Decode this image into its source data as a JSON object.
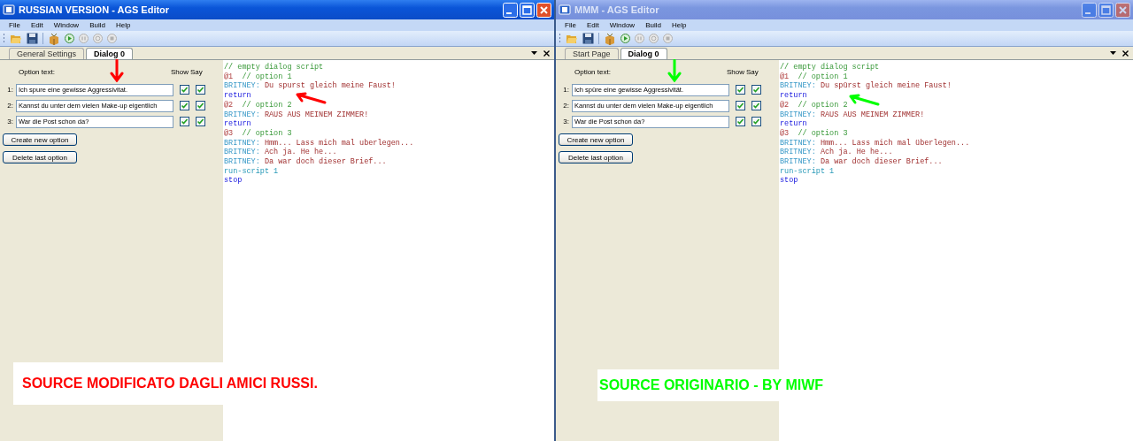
{
  "windows": [
    {
      "title": "RUSSIAN VERSION - AGS Editor",
      "active": true,
      "menu": [
        "File",
        "Edit",
        "Window",
        "Build",
        "Help"
      ],
      "tabs": [
        {
          "label": "General Settings",
          "selected": false
        },
        {
          "label": "Dialog 0",
          "selected": true
        }
      ],
      "option_header": {
        "label": "Option text:",
        "show": "Show",
        "say": "Say"
      },
      "options": [
        {
          "number": "1:",
          "text": "Ich spure eine gewisse Aggressivitat.",
          "show": true,
          "say": true
        },
        {
          "number": "2:",
          "text": "Kannst du unter dem vielen Make-up eigentlich",
          "show": true,
          "say": true
        },
        {
          "number": "3:",
          "text": "War die Post schon da?",
          "show": true,
          "say": true
        }
      ],
      "buttons": [
        "Create new option",
        "Delete last option"
      ],
      "script": [
        [
          {
            "kind": "comment",
            "text": "// empty dialog script"
          }
        ],
        [
          {
            "kind": "label",
            "text": "@1"
          },
          {
            "kind": "comment",
            "text": "  // option 1"
          }
        ],
        [
          {
            "kind": "character",
            "text": "BRITNEY:"
          },
          {
            "kind": "speech",
            "text": " Du spurst gleich meine Faust!"
          }
        ],
        [
          {
            "kind": "keyword",
            "text": "return"
          }
        ],
        [
          {
            "kind": "label",
            "text": "@2"
          },
          {
            "kind": "comment",
            "text": "  // option 2"
          }
        ],
        [
          {
            "kind": "character",
            "text": "BRITNEY:"
          },
          {
            "kind": "speech",
            "text": " RAUS AUS MEINEM ZIMMER!"
          }
        ],
        [
          {
            "kind": "keyword",
            "text": "return"
          }
        ],
        [
          {
            "kind": "label",
            "text": "@3"
          },
          {
            "kind": "comment",
            "text": "  // option 3"
          }
        ],
        [
          {
            "kind": "character",
            "text": "BRITNEY:"
          },
          {
            "kind": "speech",
            "text": " Hmm... Lass mich mal uberlegen..."
          }
        ],
        [
          {
            "kind": "character",
            "text": "BRITNEY:"
          },
          {
            "kind": "speech",
            "text": " Ach ja. He he..."
          }
        ],
        [
          {
            "kind": "character",
            "text": "BRITNEY:"
          },
          {
            "kind": "speech",
            "text": " Da war doch dieser Brief..."
          }
        ],
        [
          {
            "kind": "command",
            "text": "run-script 1"
          }
        ],
        [
          {
            "kind": "keyword",
            "text": "stop"
          }
        ]
      ],
      "caption": {
        "text": "SOURCE MODIFICATO DAGLI AMICI RUSSI.",
        "color": "#ff0000"
      }
    },
    {
      "title": "MMM - AGS Editor",
      "active": false,
      "menu": [
        "File",
        "Edit",
        "Window",
        "Build",
        "Help"
      ],
      "tabs": [
        {
          "label": "Start Page",
          "selected": false
        },
        {
          "label": "Dialog 0",
          "selected": true
        }
      ],
      "option_header": {
        "label": "Option text:",
        "show": "Show",
        "say": "Say"
      },
      "options": [
        {
          "number": "1:",
          "text": "Ich spüre eine gewisse Aggressivität.",
          "show": true,
          "say": true
        },
        {
          "number": "2:",
          "text": "Kannst du unter dem vielen Make-up eigentlich",
          "show": true,
          "say": true
        },
        {
          "number": "3:",
          "text": "War die Post schon da?",
          "show": true,
          "say": true
        }
      ],
      "buttons": [
        "Create new option",
        "Delete last option"
      ],
      "script": [
        [
          {
            "kind": "comment",
            "text": "// empty dialog script"
          }
        ],
        [
          {
            "kind": "label",
            "text": "@1"
          },
          {
            "kind": "comment",
            "text": "  // option 1"
          }
        ],
        [
          {
            "kind": "character",
            "text": "BRITNEY:"
          },
          {
            "kind": "speech",
            "text": " Du spürst gleich meine Faust!"
          }
        ],
        [
          {
            "kind": "keyword",
            "text": "return"
          }
        ],
        [
          {
            "kind": "label",
            "text": "@2"
          },
          {
            "kind": "comment",
            "text": "  // option 2"
          }
        ],
        [
          {
            "kind": "character",
            "text": "BRITNEY:"
          },
          {
            "kind": "speech",
            "text": " RAUS AUS MEINEM ZIMMER!"
          }
        ],
        [
          {
            "kind": "keyword",
            "text": "return"
          }
        ],
        [
          {
            "kind": "label",
            "text": "@3"
          },
          {
            "kind": "comment",
            "text": "  // option 3"
          }
        ],
        [
          {
            "kind": "character",
            "text": "BRITNEY:"
          },
          {
            "kind": "speech",
            "text": " Hmm... Lass mich mal überlegen..."
          }
        ],
        [
          {
            "kind": "character",
            "text": "BRITNEY:"
          },
          {
            "kind": "speech",
            "text": " Ach ja. He he..."
          }
        ],
        [
          {
            "kind": "character",
            "text": "BRITNEY:"
          },
          {
            "kind": "speech",
            "text": " Da war doch dieser Brief..."
          }
        ],
        [
          {
            "kind": "command",
            "text": "run-script 1"
          }
        ],
        [
          {
            "kind": "keyword",
            "text": "stop"
          }
        ]
      ],
      "caption": {
        "text": "SOURCE ORIGINARIO - BY MIWF",
        "color": "#00ff00"
      }
    }
  ]
}
